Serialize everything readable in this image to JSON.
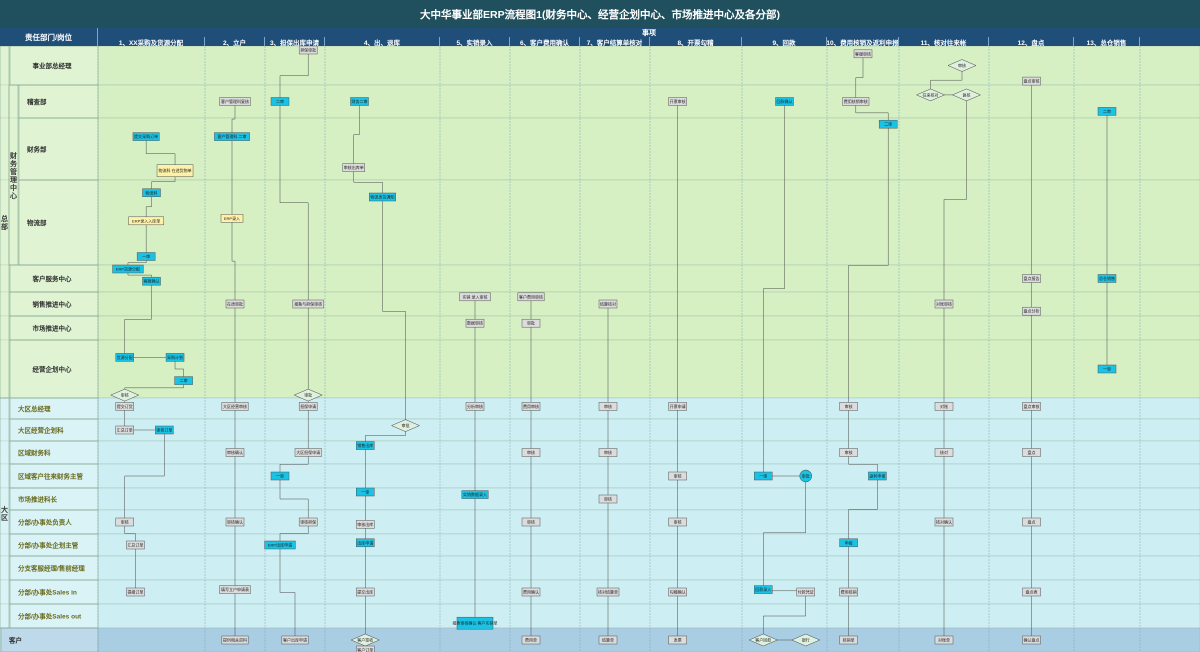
{
  "title": "大中华事业部ERP流程图1(财务中心、经营企划中心、市场推进中心及各分部)",
  "header": {
    "dept": "责任部门/岗位",
    "matters": "事项"
  },
  "columns": [
    "1、XX采购及货源分配",
    "2、立户",
    "3、担保出库申请",
    "4、出、退库",
    "5、实销录入",
    "6、客户费用确认",
    "7、客户结算单核对",
    "8、开票勾稽",
    "9、回款",
    "10、费用核销及返利申报",
    "11、核对往来帐",
    "12、盘点",
    "13、总仓销售"
  ],
  "groups": [
    {
      "id": "hq",
      "label": "总部"
    },
    {
      "id": "fin",
      "label": "财务管理中心"
    },
    {
      "id": "region",
      "label": "大区"
    },
    {
      "id": "customer",
      "label": "客户"
    }
  ],
  "lanes": [
    {
      "label": "事业部总经理",
      "group": "hq"
    },
    {
      "label": "稽查部",
      "group": "fin"
    },
    {
      "label": "财务部",
      "group": "fin"
    },
    {
      "label": "物流部",
      "group": "fin"
    },
    {
      "label": "客户服务中心",
      "group": "hq"
    },
    {
      "label": "销售推进中心",
      "group": "hq"
    },
    {
      "label": "市场推进中心",
      "group": "hq"
    },
    {
      "label": "经营企划中心",
      "group": "hq"
    },
    {
      "label": "大区总经理",
      "group": "region"
    },
    {
      "label": "大区经营企划科",
      "group": "region"
    },
    {
      "label": "区域财务科",
      "group": "region"
    },
    {
      "label": "区域客户往来财务主管",
      "group": "region"
    },
    {
      "label": "市场推进科长",
      "group": "region"
    },
    {
      "label": "分部/办事处负责人",
      "group": "region"
    },
    {
      "label": "分部/办事处企划主管",
      "group": "region"
    },
    {
      "label": "分支客服经理/售前经理",
      "group": "region"
    },
    {
      "label": "分部/办事处Sales in",
      "group": "region"
    },
    {
      "label": "分部/办事处Sales out",
      "group": "region"
    },
    {
      "label": "客户",
      "group": "customer"
    }
  ],
  "nodes": [
    {
      "text": "提交采购订单",
      "col": 0,
      "lane": 2,
      "fx": 0.45,
      "fy": 0.3,
      "kind": "cyan"
    },
    {
      "text": "物流科 在途货物单",
      "col": 0,
      "lane": 2,
      "fx": 0.72,
      "fy": 0.85,
      "kind": "yellow"
    },
    {
      "text": "物流科",
      "col": 0,
      "lane": 3,
      "fx": 0.5,
      "fy": 0.15,
      "kind": "cyan"
    },
    {
      "text": "ERP录入入库单",
      "col": 0,
      "lane": 3,
      "fx": 0.45,
      "fy": 0.48,
      "kind": "yellow"
    },
    {
      "text": "一审",
      "col": 0,
      "lane": 3,
      "fx": 0.45,
      "fy": 0.9,
      "kind": "cyan"
    },
    {
      "text": "ERP货源分配",
      "col": 0,
      "lane": 4,
      "fx": 0.28,
      "fy": 0.0,
      "kind": "cyan"
    },
    {
      "text": "客服确认",
      "col": 0,
      "lane": 4,
      "fx": 0.5,
      "fy": 0.6,
      "kind": "cyan"
    },
    {
      "text": "货源分配",
      "col": 0,
      "lane": 7,
      "fx": 0.25,
      "fy": 0.3,
      "kind": "cyan"
    },
    {
      "text": "采购计划",
      "col": 0,
      "lane": 7,
      "fx": 0.72,
      "fy": 0.3,
      "kind": "cyan"
    },
    {
      "text": "二审",
      "col": 0,
      "lane": 7,
      "fx": 0.8,
      "fy": 0.7,
      "kind": "cyan"
    },
    {
      "text": "审核",
      "col": 0,
      "lane": 7,
      "fx": 0.25,
      "fy": 0.95,
      "kind": "diamond"
    },
    {
      "text": "提交订货",
      "col": 0,
      "lane": 8,
      "fx": 0.25,
      "fy": 0.4,
      "kind": "grey"
    },
    {
      "text": "汇总订单",
      "col": 0,
      "lane": 9,
      "fx": 0.25,
      "fy": 0.5,
      "kind": "grey"
    },
    {
      "text": "审核订单",
      "col": 0,
      "lane": 9,
      "fx": 0.62,
      "fy": 0.5,
      "kind": "cyan"
    },
    {
      "text": "审核",
      "col": 0,
      "lane": 13,
      "fx": 0.25,
      "fy": 0.5,
      "kind": "grey"
    },
    {
      "text": "汇总订单",
      "col": 0,
      "lane": 14,
      "fx": 0.35,
      "fy": 0.5,
      "kind": "grey"
    },
    {
      "text": "提报订单",
      "col": 0,
      "lane": 16,
      "fx": 0.35,
      "fy": 0.5,
      "kind": "grey"
    },
    {
      "text": "客户管理科复核",
      "col": 1,
      "lane": 1,
      "fx": 0.5,
      "fy": 0.5,
      "kind": "grey"
    },
    {
      "text": "客户管理科 二审",
      "col": 1,
      "lane": 2,
      "fx": 0.45,
      "fy": 0.3,
      "kind": "cyan"
    },
    {
      "text": "ERP录入",
      "col": 1,
      "lane": 3,
      "fx": 0.45,
      "fy": 0.45,
      "kind": "yellow"
    },
    {
      "text": "在途审批",
      "col": 1,
      "lane": 5,
      "fx": 0.5,
      "fy": 0.5,
      "kind": "grey"
    },
    {
      "text": "大区经营审核",
      "col": 1,
      "lane": 8,
      "fx": 0.5,
      "fy": 0.4,
      "kind": "grey"
    },
    {
      "text": "审核确认",
      "col": 1,
      "lane": 10,
      "fx": 0.5,
      "fy": 0.5,
      "kind": "grey"
    },
    {
      "text": "审核确认",
      "col": 1,
      "lane": 13,
      "fx": 0.5,
      "fy": 0.5,
      "kind": "grey"
    },
    {
      "text": "填写立户申请表",
      "col": 1,
      "lane": 16,
      "fx": 0.5,
      "fy": 0.4,
      "kind": "grey"
    },
    {
      "text": "提供相关资料",
      "col": 1,
      "lane": 18,
      "fx": 0.5,
      "fy": 0.5,
      "kind": "grey"
    },
    {
      "text": "担保审批",
      "col": 2,
      "lane": 0,
      "fx": 0.72,
      "fy": 0.1,
      "kind": "grey"
    },
    {
      "text": "二审",
      "col": 2,
      "lane": 1,
      "fx": 0.25,
      "fy": 0.5,
      "kind": "cyan"
    },
    {
      "text": "报备与担保审核",
      "col": 2,
      "lane": 5,
      "fx": 0.72,
      "fy": 0.5,
      "kind": "grey"
    },
    {
      "text": "审批",
      "col": 2,
      "lane": 7,
      "fx": 0.72,
      "fy": 0.95,
      "kind": "diamond"
    },
    {
      "text": "担保申请",
      "col": 2,
      "lane": 8,
      "fx": 0.72,
      "fy": 0.4,
      "kind": "grey"
    },
    {
      "text": "一审",
      "col": 2,
      "lane": 11,
      "fx": 0.25,
      "fy": 0.5,
      "kind": "cyan"
    },
    {
      "text": "大区担保申请",
      "col": 2,
      "lane": 10,
      "fx": 0.72,
      "fy": 0.5,
      "kind": "grey"
    },
    {
      "text": "审核担保",
      "col": 2,
      "lane": 13,
      "fx": 0.72,
      "fy": 0.5,
      "kind": "grey"
    },
    {
      "text": "ERP出库申请",
      "col": 2,
      "lane": 14,
      "fx": 0.25,
      "fy": 0.5,
      "kind": "cyan"
    },
    {
      "text": "客户出库申请",
      "col": 2,
      "lane": 18,
      "fx": 0.5,
      "fy": 0.5,
      "kind": "grey"
    },
    {
      "text": "财务二审",
      "col": 3,
      "lane": 1,
      "fx": 0.3,
      "fy": 0.5,
      "kind": "cyan"
    },
    {
      "text": "审核出库单",
      "col": 3,
      "lane": 2,
      "fx": 0.25,
      "fy": 0.8,
      "kind": "grey"
    },
    {
      "text": "物流发货通知",
      "col": 3,
      "lane": 3,
      "fx": 0.5,
      "fy": 0.2,
      "kind": "cyan"
    },
    {
      "text": "销售出库",
      "col": 3,
      "lane": 10,
      "fx": 0.35,
      "fy": 0.2,
      "kind": "cyan"
    },
    {
      "text": "审批",
      "col": 3,
      "lane": 9,
      "fx": 0.7,
      "fy": 0.3,
      "kind": "diamond"
    },
    {
      "text": "一审",
      "col": 3,
      "lane": 12,
      "fx": 0.35,
      "fy": 0.0,
      "kind": "cyan"
    },
    {
      "text": "审核出库",
      "col": 3,
      "lane": 13,
      "fx": 0.35,
      "fy": 0.6,
      "kind": "grey"
    },
    {
      "text": "出库申请",
      "col": 3,
      "lane": 14,
      "fx": 0.35,
      "fy": 0.4,
      "kind": "cyan"
    },
    {
      "text": "提交出库",
      "col": 3,
      "lane": 16,
      "fx": 0.35,
      "fy": 0.5,
      "kind": "grey"
    },
    {
      "text": "客户签收",
      "col": 3,
      "lane": 18,
      "fx": 0.35,
      "fy": 0.5,
      "kind": "diamond"
    },
    {
      "text": "客户订单",
      "col": 3,
      "lane": 18,
      "fx": 0.35,
      "fy": 1.0,
      "kind": "grey"
    },
    {
      "text": "实销 录入审核",
      "col": 4,
      "lane": 5,
      "fx": 0.5,
      "fy": 0.2,
      "kind": "grey"
    },
    {
      "text": "数据审核",
      "col": 4,
      "lane": 6,
      "fx": 0.5,
      "fy": 0.3,
      "kind": "grey"
    },
    {
      "text": "分析审核",
      "col": 4,
      "lane": 8,
      "fx": 0.5,
      "fy": 0.4,
      "kind": "grey"
    },
    {
      "text": "实销数据录入",
      "col": 4,
      "lane": 12,
      "fx": 0.5,
      "fy": 0.3,
      "kind": "cyan"
    },
    {
      "text": "报表审核确认 客户实销单",
      "col": 4,
      "lane": 17,
      "fx": 0.5,
      "fy": 0.8,
      "kind": "cyan"
    },
    {
      "text": "客户费用审核",
      "col": 5,
      "lane": 5,
      "fx": 0.3,
      "fy": 0.2,
      "kind": "grey"
    },
    {
      "text": "审批",
      "col": 5,
      "lane": 6,
      "fx": 0.3,
      "fy": 0.3,
      "kind": "grey"
    },
    {
      "text": "费用审核",
      "col": 5,
      "lane": 8,
      "fx": 0.3,
      "fy": 0.4,
      "kind": "grey"
    },
    {
      "text": "审核",
      "col": 5,
      "lane": 10,
      "fx": 0.3,
      "fy": 0.5,
      "kind": "grey"
    },
    {
      "text": "审核",
      "col": 5,
      "lane": 13,
      "fx": 0.3,
      "fy": 0.5,
      "kind": "grey"
    },
    {
      "text": "费用确认",
      "col": 5,
      "lane": 16,
      "fx": 0.3,
      "fy": 0.5,
      "kind": "grey"
    },
    {
      "text": "费用单",
      "col": 5,
      "lane": 18,
      "fx": 0.3,
      "fy": 0.5,
      "kind": "grey"
    },
    {
      "text": "结算核对",
      "col": 6,
      "lane": 5,
      "fx": 0.4,
      "fy": 0.5,
      "kind": "grey"
    },
    {
      "text": "审核",
      "col": 6,
      "lane": 8,
      "fx": 0.4,
      "fy": 0.4,
      "kind": "grey"
    },
    {
      "text": "审核",
      "col": 6,
      "lane": 10,
      "fx": 0.4,
      "fy": 0.5,
      "kind": "grey"
    },
    {
      "text": "审核",
      "col": 6,
      "lane": 12,
      "fx": 0.4,
      "fy": 0.5,
      "kind": "grey"
    },
    {
      "text": "核对结算单",
      "col": 6,
      "lane": 16,
      "fx": 0.4,
      "fy": 0.5,
      "kind": "grey"
    },
    {
      "text": "结算单",
      "col": 6,
      "lane": 18,
      "fx": 0.4,
      "fy": 0.5,
      "kind": "grey"
    },
    {
      "text": "开票审核",
      "col": 7,
      "lane": 1,
      "fx": 0.3,
      "fy": 0.5,
      "kind": "grey"
    },
    {
      "text": "开票申请",
      "col": 7,
      "lane": 8,
      "fx": 0.3,
      "fy": 0.4,
      "kind": "grey"
    },
    {
      "text": "审核",
      "col": 7,
      "lane": 11,
      "fx": 0.3,
      "fy": 0.5,
      "kind": "grey"
    },
    {
      "text": "审核",
      "col": 7,
      "lane": 13,
      "fx": 0.3,
      "fy": 0.5,
      "kind": "grey"
    },
    {
      "text": "勾稽确认",
      "col": 7,
      "lane": 16,
      "fx": 0.3,
      "fy": 0.5,
      "kind": "grey"
    },
    {
      "text": "发票",
      "col": 7,
      "lane": 18,
      "fx": 0.3,
      "fy": 0.5,
      "kind": "grey"
    },
    {
      "text": "回款确认",
      "col": 8,
      "lane": 1,
      "fx": 0.5,
      "fy": 0.5,
      "kind": "cyan"
    },
    {
      "text": "一审",
      "col": 8,
      "lane": 11,
      "fx": 0.25,
      "fy": 0.5,
      "kind": "cyan"
    },
    {
      "text": "审批",
      "col": 8,
      "lane": 11,
      "fx": 0.75,
      "fy": 0.5,
      "kind": "circle"
    },
    {
      "text": "回款录入",
      "col": 8,
      "lane": 16,
      "fx": 0.25,
      "fy": 0.4,
      "kind": "cyan"
    },
    {
      "text": "付款凭证",
      "col": 8,
      "lane": 16,
      "fx": 0.75,
      "fy": 0.5,
      "kind": "grey"
    },
    {
      "text": "客户回款",
      "col": 8,
      "lane": 18,
      "fx": 0.25,
      "fy": 0.5,
      "kind": "diamond"
    },
    {
      "text": "银行",
      "col": 8,
      "lane": 18,
      "fx": 0.75,
      "fy": 0.5,
      "kind": "diamond"
    },
    {
      "text": "客服审核",
      "col": 9,
      "lane": 0,
      "fx": 0.5,
      "fy": 0.2,
      "kind": "grey"
    },
    {
      "text": "费用核销审核",
      "col": 9,
      "lane": 1,
      "fx": 0.4,
      "fy": 0.5,
      "kind": "grey"
    },
    {
      "text": "二审",
      "col": 9,
      "lane": 2,
      "fx": 0.85,
      "fy": 0.1,
      "kind": "cyan"
    },
    {
      "text": "审核",
      "col": 9,
      "lane": 8,
      "fx": 0.3,
      "fy": 0.4,
      "kind": "grey"
    },
    {
      "text": "审核",
      "col": 9,
      "lane": 10,
      "fx": 0.3,
      "fy": 0.5,
      "kind": "grey"
    },
    {
      "text": "返利申报",
      "col": 9,
      "lane": 11,
      "fx": 0.7,
      "fy": 0.5,
      "kind": "cyan"
    },
    {
      "text": "申报",
      "col": 9,
      "lane": 14,
      "fx": 0.3,
      "fy": 0.4,
      "kind": "cyan"
    },
    {
      "text": "费用核销",
      "col": 9,
      "lane": 16,
      "fx": 0.3,
      "fy": 0.5,
      "kind": "grey"
    },
    {
      "text": "核销单",
      "col": 9,
      "lane": 18,
      "fx": 0.3,
      "fy": 0.5,
      "kind": "grey"
    },
    {
      "text": "往来核对",
      "col": 10,
      "lane": 1,
      "fx": 0.35,
      "fy": 0.3,
      "kind": "diamond"
    },
    {
      "text": "审核",
      "col": 10,
      "lane": 0,
      "fx": 0.7,
      "fy": 0.5,
      "kind": "diamond"
    },
    {
      "text": "复核",
      "col": 10,
      "lane": 1,
      "fx": 0.75,
      "fy": 0.3,
      "kind": "diamond"
    },
    {
      "text": "对账审核",
      "col": 10,
      "lane": 5,
      "fx": 0.5,
      "fy": 0.5,
      "kind": "grey"
    },
    {
      "text": "对账",
      "col": 10,
      "lane": 8,
      "fx": 0.5,
      "fy": 0.4,
      "kind": "grey"
    },
    {
      "text": "核对",
      "col": 10,
      "lane": 10,
      "fx": 0.5,
      "fy": 0.5,
      "kind": "grey"
    },
    {
      "text": "核对确认",
      "col": 10,
      "lane": 13,
      "fx": 0.5,
      "fy": 0.5,
      "kind": "grey"
    },
    {
      "text": "对账单",
      "col": 10,
      "lane": 18,
      "fx": 0.5,
      "fy": 0.5,
      "kind": "grey"
    },
    {
      "text": "盘点审核",
      "col": 11,
      "lane": 0,
      "fx": 0.5,
      "fy": 0.9,
      "kind": "grey"
    },
    {
      "text": "盘点报告",
      "col": 11,
      "lane": 4,
      "fx": 0.5,
      "fy": 0.5,
      "kind": "grey"
    },
    {
      "text": "盘点分析",
      "col": 11,
      "lane": 5,
      "fx": 0.5,
      "fy": 0.8,
      "kind": "grey"
    },
    {
      "text": "盘点审核",
      "col": 11,
      "lane": 8,
      "fx": 0.5,
      "fy": 0.4,
      "kind": "grey"
    },
    {
      "text": "盘点",
      "col": 11,
      "lane": 10,
      "fx": 0.5,
      "fy": 0.5,
      "kind": "grey"
    },
    {
      "text": "盘点",
      "col": 11,
      "lane": 13,
      "fx": 0.5,
      "fy": 0.5,
      "kind": "grey"
    },
    {
      "text": "盘点表",
      "col": 11,
      "lane": 16,
      "fx": 0.5,
      "fy": 0.5,
      "kind": "grey"
    },
    {
      "text": "确认盘点",
      "col": 11,
      "lane": 18,
      "fx": 0.5,
      "fy": 0.5,
      "kind": "grey"
    },
    {
      "text": "二审",
      "col": 12,
      "lane": 1,
      "fx": 0.5,
      "fy": 0.8,
      "kind": "cyan"
    },
    {
      "text": "总仓销售",
      "col": 12,
      "lane": 4,
      "fx": 0.5,
      "fy": 0.5,
      "kind": "cyan"
    },
    {
      "text": "一审",
      "col": 12,
      "lane": 7,
      "fx": 0.5,
      "fy": 0.5,
      "kind": "cyan"
    }
  ],
  "colors": {
    "header": "#1f4e79",
    "title": "#20505d",
    "hq_bg": "#d6f0c4",
    "region_bg": "#cdeff3",
    "customer_bg": "#a9cde3",
    "cyan_node": "#19c3e6",
    "grey_node": "#dcdcdc",
    "yellow_node": "#fff2a8"
  }
}
